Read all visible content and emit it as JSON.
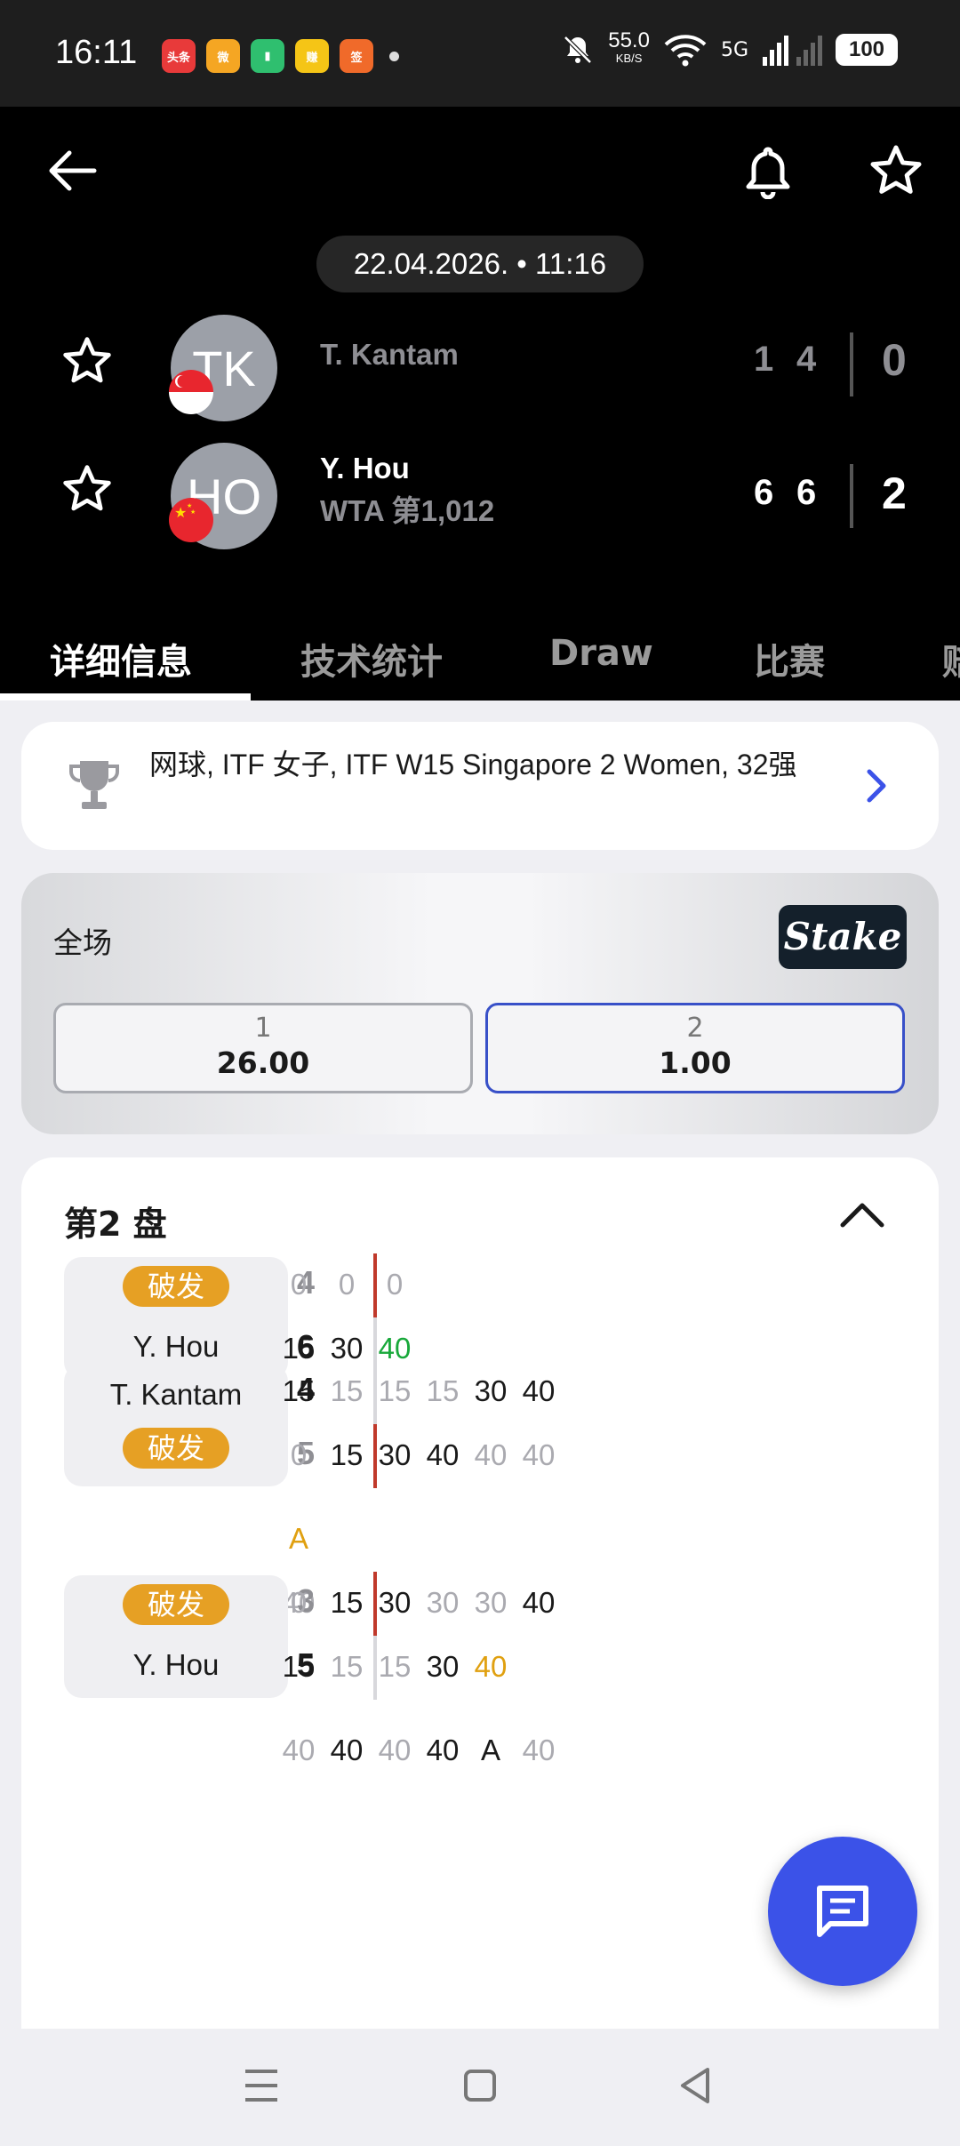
{
  "status_bar": {
    "time": "16:11",
    "apps": [
      {
        "name": "toutiao-app-icon",
        "label": "头条",
        "color": "#e83a3a"
      },
      {
        "name": "weibo-app-icon",
        "label": "微",
        "color": "#f5a623"
      },
      {
        "name": "battery-app-icon",
        "label": "▮",
        "color": "#2fbf6f"
      },
      {
        "name": "yellow-app-icon",
        "label": "赚",
        "color": "#f5c516"
      },
      {
        "name": "orange-app-icon",
        "label": "签",
        "color": "#f06a2a"
      }
    ],
    "net_speed": "55.0",
    "net_unit": "KB/S",
    "signal": "5G",
    "battery": "100"
  },
  "header": {
    "date_time": "22.04.2026. • 11:16",
    "players": [
      {
        "initials": "TK",
        "name": "T. Kantam",
        "rank": "",
        "flag": "singapore",
        "game_scores": [
          "1",
          "4"
        ],
        "sets": "0",
        "muted": true
      },
      {
        "initials": "HO",
        "name": "Y. Hou",
        "rank": "WTA 第1,012",
        "flag": "china",
        "game_scores": [
          "6",
          "6"
        ],
        "sets": "2",
        "muted": false
      }
    ]
  },
  "tabs": [
    {
      "label": "详细信息",
      "active": true
    },
    {
      "label": "技术统计",
      "active": false
    },
    {
      "label": "Draw",
      "active": false
    },
    {
      "label": "比赛",
      "active": false
    },
    {
      "label": "赔",
      "active": false
    }
  ],
  "tournament": {
    "text": "网球, ITF 女子, ITF W15 Singapore 2 Women, 32强"
  },
  "odds": {
    "title": "全场",
    "provider": "Stake",
    "options": [
      {
        "label": "1",
        "value": "26.00",
        "selected": false
      },
      {
        "label": "2",
        "value": "1.00",
        "selected": true
      }
    ]
  },
  "set_detail": {
    "title": "第2 盘",
    "break_label": "破发",
    "games": [
      {
        "player": "Y. Hou",
        "server_on_top": false,
        "score_top": "4",
        "score_bottom": "6",
        "points_top": [
          {
            "v": "0",
            "c": "l"
          },
          {
            "v": "0",
            "c": "l"
          },
          {
            "v": "0",
            "c": "l"
          }
        ],
        "points_bottom": [
          {
            "v": "15",
            "c": "d"
          },
          {
            "v": "30",
            "c": "d"
          },
          {
            "v": "40",
            "c": "g"
          }
        ],
        "extra": []
      },
      {
        "player": "T. Kantam",
        "server_on_top": true,
        "score_top": "4",
        "score_bottom": "5",
        "points_top": [
          {
            "v": "15",
            "c": "d"
          },
          {
            "v": "15",
            "c": "l"
          },
          {
            "v": "15",
            "c": "l"
          },
          {
            "v": "15",
            "c": "l"
          },
          {
            "v": "30",
            "c": "d"
          },
          {
            "v": "40",
            "c": "d"
          }
        ],
        "points_bottom": [
          {
            "v": "0",
            "c": "l"
          },
          {
            "v": "15",
            "c": "d"
          },
          {
            "v": "30",
            "c": "d"
          },
          {
            "v": "40",
            "c": "d"
          },
          {
            "v": "40",
            "c": "l"
          },
          {
            "v": "40",
            "c": "l"
          }
        ],
        "extra": [
          [
            {
              "v": "A",
              "c": "o"
            }
          ],
          [
            {
              "v": "40",
              "c": "l"
            }
          ]
        ]
      },
      {
        "player": "Y. Hou",
        "server_on_top": false,
        "score_top": "3",
        "score_bottom": "5",
        "points_top": [
          {
            "v": "0",
            "c": "l"
          },
          {
            "v": "15",
            "c": "d"
          },
          {
            "v": "30",
            "c": "d"
          },
          {
            "v": "30",
            "c": "l"
          },
          {
            "v": "30",
            "c": "l"
          },
          {
            "v": "40",
            "c": "d"
          }
        ],
        "points_bottom": [
          {
            "v": "15",
            "c": "d"
          },
          {
            "v": "15",
            "c": "l"
          },
          {
            "v": "15",
            "c": "l"
          },
          {
            "v": "30",
            "c": "d"
          },
          {
            "v": "40",
            "c": "o"
          },
          {
            "v": "",
            "c": "d"
          }
        ],
        "extra": [
          [
            {
              "v": "40",
              "c": "l"
            },
            {
              "v": "40",
              "c": "d"
            },
            {
              "v": "40",
              "c": "l"
            },
            {
              "v": "40",
              "c": "d"
            },
            {
              "v": "A",
              "c": "d"
            },
            {
              "v": "40",
              "c": "l"
            }
          ]
        ]
      }
    ]
  },
  "colors": {
    "accent": "#3b52e8",
    "break_badge": "#e6a024",
    "serve_line": "#c0392b",
    "point_win": "#18a83a",
    "advantage": "#e0a010"
  }
}
